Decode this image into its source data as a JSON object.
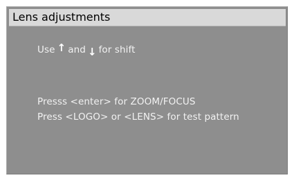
{
  "window": {
    "title": "Lens adjustments"
  },
  "instructions": {
    "shift_prefix": "Use",
    "shift_up_icon": "arrow-up-icon",
    "shift_up_glyph": "↑",
    "shift_middle": "and",
    "shift_down_icon": "arrow-down-icon",
    "shift_down_glyph": "↓",
    "shift_suffix": "for shift",
    "zoom_focus": "Presss <enter> for ZOOM/FOCUS",
    "test_pattern": "Press <LOGO> or <LENS> for test pattern"
  }
}
